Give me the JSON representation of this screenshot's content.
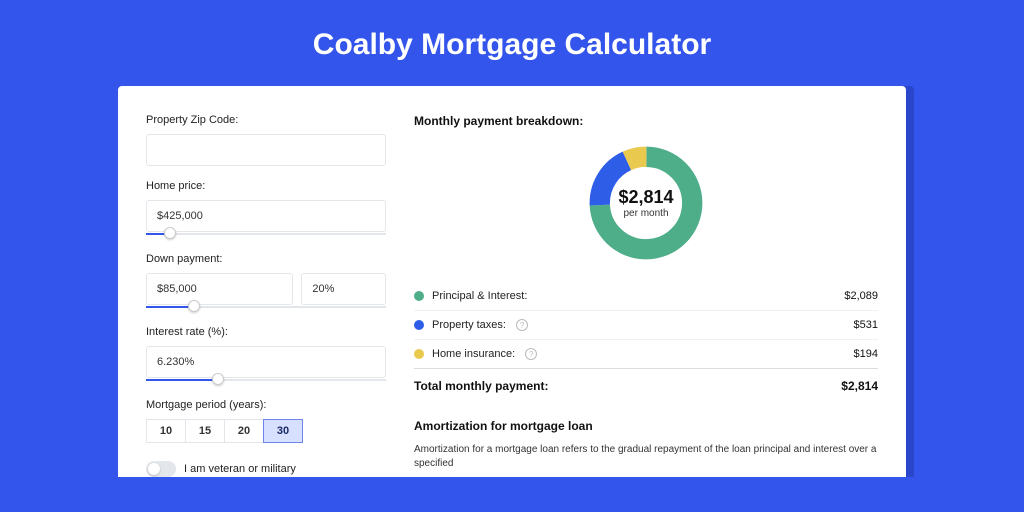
{
  "title": "Coalby Mortgage Calculator",
  "form": {
    "zip_label": "Property Zip Code:",
    "zip_value": "",
    "price_label": "Home price:",
    "price_value": "$425,000",
    "price_slider_pct": 10,
    "down_label": "Down payment:",
    "down_amount": "$85,000",
    "down_percent": "20%",
    "down_slider_pct": 20,
    "rate_label": "Interest rate (%):",
    "rate_value": "6.230%",
    "rate_slider_pct": 30,
    "period_label": "Mortgage period (years):",
    "periods": [
      "10",
      "15",
      "20",
      "30"
    ],
    "period_selected_index": 3,
    "veteran_label": "I am veteran or military"
  },
  "breakdown": {
    "title": "Monthly payment breakdown:",
    "center_amount": "$2,814",
    "center_sub": "per month",
    "items": [
      {
        "label": "Principal & Interest:",
        "value": "$2,089",
        "color": "#4fae8a",
        "fraction": 0.742,
        "has_help": false
      },
      {
        "label": "Property taxes:",
        "value": "$531",
        "color": "#2e5ee8",
        "fraction": 0.189,
        "has_help": true
      },
      {
        "label": "Home insurance:",
        "value": "$194",
        "color": "#eac94f",
        "fraction": 0.069,
        "has_help": true
      }
    ],
    "total_label": "Total monthly payment:",
    "total_value": "$2,814"
  },
  "amort": {
    "title": "Amortization for mortgage loan",
    "text": "Amortization for a mortgage loan refers to the gradual repayment of the loan principal and interest over a specified"
  },
  "chart_data": {
    "type": "pie",
    "title": "Monthly payment breakdown",
    "series": [
      {
        "name": "Principal & Interest",
        "value": 2089,
        "color": "#4fae8a"
      },
      {
        "name": "Property taxes",
        "value": 531,
        "color": "#2e5ee8"
      },
      {
        "name": "Home insurance",
        "value": 194,
        "color": "#eac94f"
      }
    ],
    "total": 2814,
    "center_label": "$2,814 per month"
  }
}
